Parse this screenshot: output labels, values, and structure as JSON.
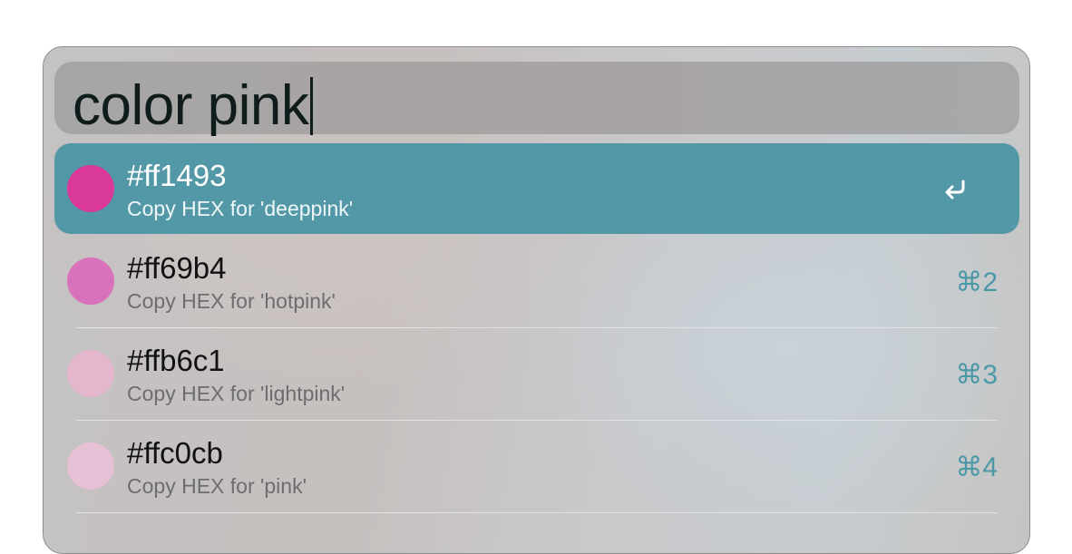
{
  "search": {
    "query": "color pink"
  },
  "results": [
    {
      "title": "#ff1493",
      "subtitle": "Copy HEX for 'deeppink'",
      "color": "#d8399b",
      "shortcut": "",
      "selected": true,
      "action_icon": "return-icon"
    },
    {
      "title": "#ff69b4",
      "subtitle": "Copy HEX for 'hotpink'",
      "color": "#d872bd",
      "shortcut": "⌘2",
      "selected": false
    },
    {
      "title": "#ffb6c1",
      "subtitle": "Copy HEX for 'lightpink'",
      "color": "#e5b7cc",
      "shortcut": "⌘3",
      "selected": false
    },
    {
      "title": "#ffc0cb",
      "subtitle": "Copy HEX for 'pink'",
      "color": "#e6c0d5",
      "shortcut": "⌘4",
      "selected": false
    }
  ],
  "colors": {
    "selected_row": "#5398a6",
    "shortcut_text": "#4c98a7",
    "search_text": "#0f1c1b"
  }
}
